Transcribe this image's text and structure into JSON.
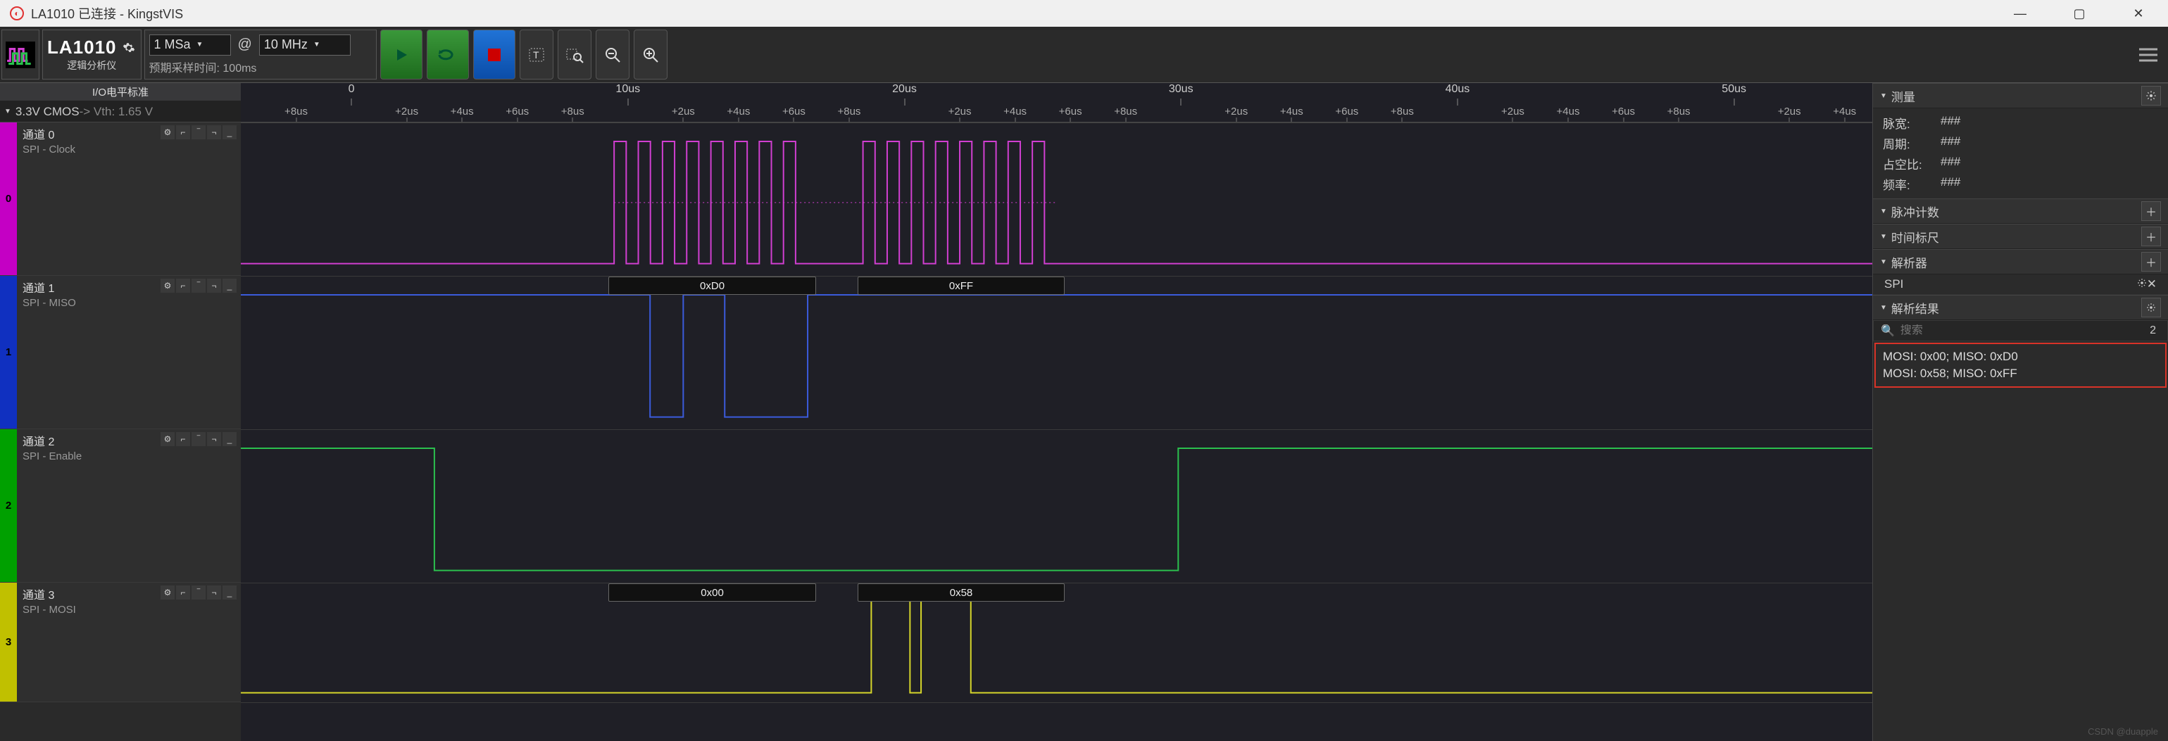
{
  "titlebar": {
    "text": "LA1010 已连接 - KingstVIS"
  },
  "device": {
    "name": "LA1010",
    "subtitle": "逻辑分析仪"
  },
  "sampling": {
    "depth": "1 MSa",
    "at_label": "@",
    "rate": "10 MHz",
    "expected_label": "预期采样时间: 100ms"
  },
  "header2": {
    "io_std": "I/O电平标准",
    "cmos": "3.3V CMOS",
    "vth": " -> Vth: 1.65 V"
  },
  "ruler": {
    "majors": [
      "0",
      "10us",
      "20us",
      "30us",
      "40us",
      "50us"
    ],
    "minors": [
      "+2us",
      "+4us",
      "+6us",
      "+8us"
    ]
  },
  "channels": [
    {
      "index": "0",
      "name": "通道 0",
      "sub": "SPI - Clock",
      "color": "#d13fd1",
      "badge": "#c400c4"
    },
    {
      "index": "1",
      "name": "通道 1",
      "sub": "SPI - MISO",
      "color": "#3b5bdc",
      "badge": "#1030c0"
    },
    {
      "index": "2",
      "name": "通道 2",
      "sub": "SPI - Enable",
      "color": "#2bbf4e",
      "badge": "#00a000"
    },
    {
      "index": "3",
      "name": "通道 3",
      "sub": "SPI - MOSI",
      "color": "#d6d62b",
      "badge": "#c0c000"
    }
  ],
  "decode": {
    "ch1": [
      "0xD0",
      "0xFF"
    ],
    "ch3": [
      "0x00",
      "0x58"
    ]
  },
  "right": {
    "measure": {
      "title": "测量",
      "rows": [
        {
          "k": "脉宽:",
          "v": "###"
        },
        {
          "k": "周期:",
          "v": "###"
        },
        {
          "k": "占空比:",
          "v": "###"
        },
        {
          "k": "频率:",
          "v": "###"
        }
      ]
    },
    "pulse": {
      "title": "脉冲计数"
    },
    "ruler": {
      "title": "时间标尺"
    },
    "decoder": {
      "title": "解析器",
      "item": "SPI"
    },
    "results": {
      "title": "解析结果",
      "search_placeholder": "搜索",
      "count": "2",
      "rows": [
        "MOSI: 0x00;   MISO: 0xD0",
        "MOSI: 0x58;   MISO: 0xFF"
      ]
    }
  },
  "watermark": "CSDN @duapple",
  "chart_data": {
    "type": "logic-analyzer",
    "time_unit": "us",
    "view_range": [
      -4,
      55
    ],
    "sample_rate": "10 MHz",
    "sample_depth": "1 MSa",
    "signals": [
      {
        "name": "SPI - Clock",
        "channel": 0,
        "description": "8 high pulses ~9.5–16.5us, gap, 8 high pulses ~18.5–25.5us; low otherwise",
        "bursts": [
          {
            "start_us": 9.5,
            "end_us": 16.5,
            "pulses": 8
          },
          {
            "start_us": 18.5,
            "end_us": 25.5,
            "pulses": 8
          }
        ]
      },
      {
        "name": "SPI - MISO",
        "channel": 1,
        "initial": 1,
        "edges_us": [
          [
            10.8,
            0
          ],
          [
            12.0,
            1
          ],
          [
            13.5,
            0
          ],
          [
            16.5,
            1
          ]
        ],
        "decoded_bytes": [
          "0xD0",
          "0xFF"
        ]
      },
      {
        "name": "SPI - Enable",
        "channel": 2,
        "initial": 1,
        "edges_us": [
          [
            3.0,
            0
          ],
          [
            29.9,
            1
          ]
        ]
      },
      {
        "name": "SPI - MOSI",
        "channel": 3,
        "initial": 0,
        "edges_us": [
          [
            16.5,
            0
          ],
          [
            18.8,
            1
          ],
          [
            20.2,
            0
          ],
          [
            20.6,
            1
          ],
          [
            22.4,
            0
          ]
        ],
        "decoded_bytes": [
          "0x00",
          "0x58"
        ]
      }
    ]
  }
}
